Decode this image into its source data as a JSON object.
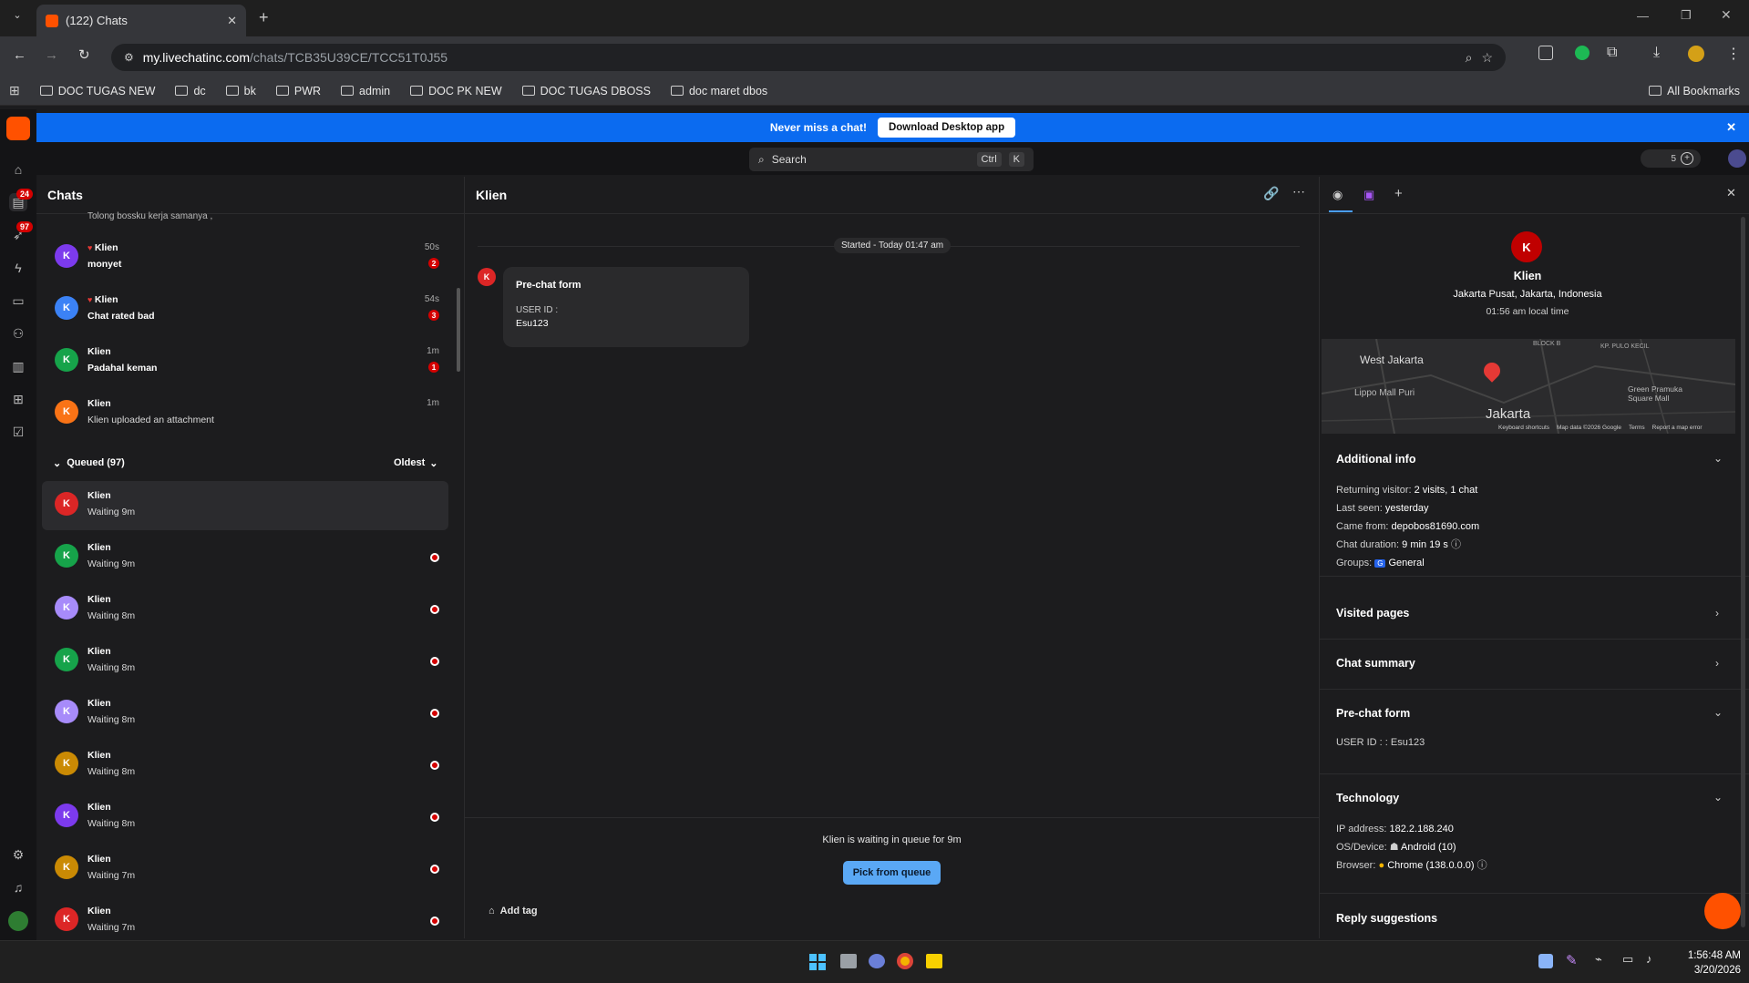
{
  "browser": {
    "tab_title": "(122) Chats",
    "url_domain": "my.livechatinc.com",
    "url_path": "/chats/TCB35U39CE/TCC51T0J55",
    "bookmarks": [
      "DOC TUGAS NEW",
      "dc",
      "bk",
      "PWR",
      "admin",
      "DOC PK NEW",
      "DOC TUGAS DBOSS",
      "doc maret dbos"
    ],
    "all_bookmarks": "All Bookmarks"
  },
  "rail": {
    "chats_badge": "24",
    "traffic_badge": "97"
  },
  "banner": {
    "text": "Never miss a chat!",
    "button": "Download Desktop app"
  },
  "search": {
    "placeholder": "Search",
    "key1": "Ctrl",
    "key2": "K"
  },
  "topbar": {
    "count": "5"
  },
  "chats": {
    "title": "Chats",
    "partial_msg": "Tolong bossku kerja samanya ,",
    "active": [
      {
        "name": "Klien",
        "msg": "monyet",
        "time": "50s",
        "unread": "2",
        "color": "#7c3aed",
        "bold": true
      },
      {
        "name": "Klien",
        "msg": "Chat rated bad",
        "time": "54s",
        "unread": "3",
        "color": "#3b82f6",
        "bold": true
      },
      {
        "name": "Klien",
        "msg": "Padahal keman",
        "time": "1m",
        "unread": "1",
        "color": "#16a34a",
        "bold": true
      },
      {
        "name": "Klien",
        "msg": "Klien uploaded an attachment",
        "time": "1m",
        "unread": "",
        "color": "#f97316",
        "bold": false
      }
    ],
    "queued_label": "Queued (97)",
    "sort_label": "Oldest",
    "queued": [
      {
        "name": "Klien",
        "msg": "Waiting 9m",
        "color": "#dc2626",
        "dot": false
      },
      {
        "name": "Klien",
        "msg": "Waiting 9m",
        "color": "#16a34a",
        "dot": true
      },
      {
        "name": "Klien",
        "msg": "Waiting 8m",
        "color": "#a78bfa",
        "dot": true
      },
      {
        "name": "Klien",
        "msg": "Waiting 8m",
        "color": "#16a34a",
        "dot": true
      },
      {
        "name": "Klien",
        "msg": "Waiting 8m",
        "color": "#a78bfa",
        "dot": true
      },
      {
        "name": "Klien",
        "msg": "Waiting 8m",
        "color": "#ca8a04",
        "dot": true
      },
      {
        "name": "Klien",
        "msg": "Waiting 8m",
        "color": "#7c3aed",
        "dot": true
      },
      {
        "name": "Klien",
        "msg": "Waiting 7m",
        "color": "#ca8a04",
        "dot": true
      },
      {
        "name": "Klien",
        "msg": "Waiting 7m",
        "color": "#dc2626",
        "dot": true
      }
    ]
  },
  "main": {
    "title": "Klien",
    "started": "Started - Today 01:47 am",
    "form_title": "Pre-chat form",
    "form_label": "USER ID :",
    "form_value": "Esu123",
    "avatar_letter": "K",
    "queue_text": "Klien is waiting in queue for 9m",
    "pick_button": "Pick from queue",
    "add_tag": "Add tag"
  },
  "details": {
    "avatar_letter": "K",
    "name": "Klien",
    "location": "Jakarta Pusat, Jakarta, Indonesia",
    "local_time": "01:56 am local time",
    "map": {
      "labels": [
        "West Jakarta",
        "Lippo Mall Puri",
        "Jakarta",
        "Green Pramuka Square Mall",
        "BLOCK B",
        "KP. PULO KECIL"
      ],
      "footer": [
        "Keyboard shortcuts",
        "Map data ©2026 Google",
        "Terms",
        "Report a map error"
      ]
    },
    "additional_title": "Additional info",
    "additional": [
      {
        "k": "Returning visitor:",
        "v": "2 visits, 1 chat"
      },
      {
        "k": "Last seen:",
        "v": "yesterday"
      },
      {
        "k": "Came from:",
        "v": "depobos81690.com"
      },
      {
        "k": "Chat duration:",
        "v": "9 min 19 s"
      },
      {
        "k": "Groups:",
        "v": "General",
        "tag": "G"
      }
    ],
    "visited_title": "Visited pages",
    "summary_title": "Chat summary",
    "prechat_title": "Pre-chat form",
    "prechat_line": "USER ID : : Esu123",
    "tech_title": "Technology",
    "tech": [
      {
        "k": "IP address:",
        "v": "182.2.188.240"
      },
      {
        "k": "OS/Device:",
        "v": "Android (10)"
      },
      {
        "k": "Browser:",
        "v": "Chrome (138.0.0.0)"
      }
    ],
    "reply_title": "Reply suggestions"
  },
  "taskbar": {
    "time": "1:56:48 AM",
    "date": "3/20/2026"
  }
}
